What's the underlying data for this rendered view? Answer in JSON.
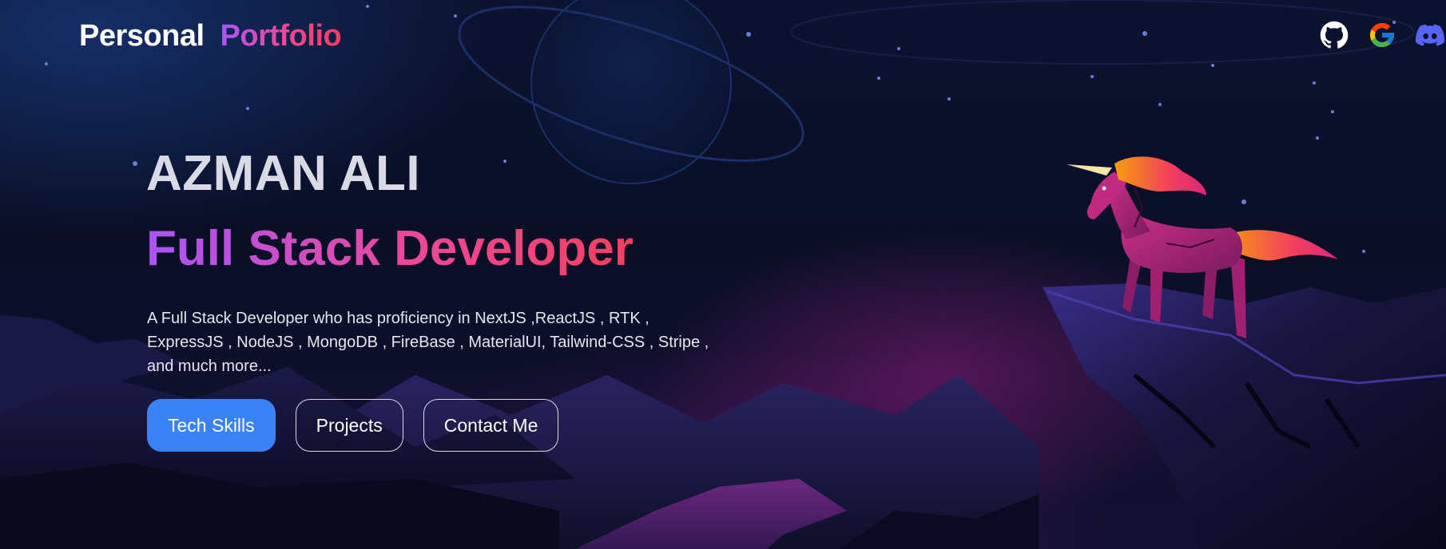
{
  "nav": {
    "logo_primary": "Personal",
    "logo_accent": "Portfolio",
    "socials": [
      {
        "name": "github",
        "icon": "github-icon"
      },
      {
        "name": "google",
        "icon": "google-icon"
      },
      {
        "name": "discord",
        "icon": "discord-icon"
      }
    ]
  },
  "hero": {
    "name": "AZMAN ALI",
    "role": "Full Stack Developer",
    "description_lines": [
      "A Full Stack Developer who has proficiency in NextJS ,ReactJS , RTK ,",
      "ExpressJS , NodeJS , MongoDB , FireBase , MaterialUI, Tailwind-CSS , Stripe ,",
      "and much more..."
    ],
    "buttons": {
      "tech_skills": "Tech Skills",
      "projects": "Projects",
      "contact": "Contact Me"
    }
  },
  "colors": {
    "primary_button": "#3b82f6",
    "gradient_start": "#a855f7",
    "gradient_mid": "#ec4899",
    "gradient_end": "#f43f5e",
    "background": "#0a0d1f"
  }
}
